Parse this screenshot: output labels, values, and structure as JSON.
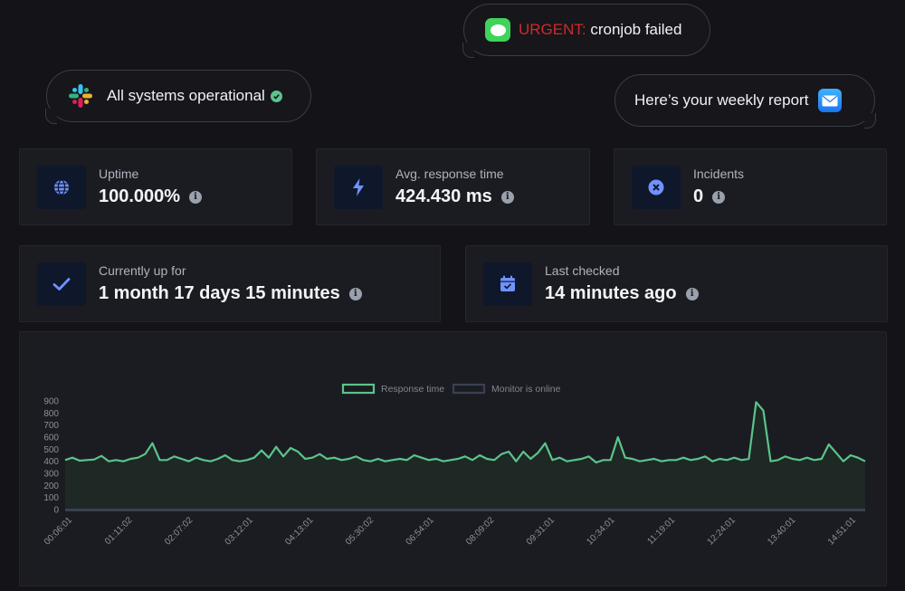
{
  "notifications": {
    "slack": {
      "text": "All systems operational",
      "icon": "slack-icon"
    },
    "sms": {
      "urgent_label": "URGENT:",
      "text": " cronjob failed",
      "icon": "messages-icon"
    },
    "mail": {
      "text": "Here’s your weekly report",
      "icon": "mail-icon"
    }
  },
  "stats": {
    "uptime": {
      "label": "Uptime",
      "value": "100.000%",
      "icon": "globe-icon"
    },
    "response": {
      "label": "Avg. response time",
      "value": "424.430 ms",
      "icon": "lightning-icon"
    },
    "incidents": {
      "label": "Incidents",
      "value": "0",
      "icon": "x-circle-icon"
    },
    "up_for": {
      "label": "Currently up for",
      "value": "1 month 17 days 15 minutes",
      "icon": "checkmark-icon"
    },
    "last_checked": {
      "label": "Last checked",
      "value": "14 minutes ago",
      "icon": "calendar-check-icon"
    }
  },
  "colors": {
    "response_line": "#5bc48b",
    "online_line": "#3b4052",
    "urgent": "#d02a2a",
    "icon_blue": "#6f92ff"
  },
  "chart_data": {
    "type": "line",
    "legend": [
      "Response time",
      "Monitor is online"
    ],
    "legend_position": "top-center",
    "ylim": [
      0,
      900
    ],
    "yticks": [
      0,
      100,
      200,
      300,
      400,
      500,
      600,
      700,
      800,
      900
    ],
    "x_tick_labels": [
      "00:06:01",
      "01:11:02",
      "02:07:02",
      "03:12:01",
      "04:13:01",
      "05:30:02",
      "06:54:01",
      "08:09:02",
      "09:31:01",
      "10:34:01",
      "11:19:01",
      "12:24:01",
      "13:40:01",
      "14:51:01"
    ],
    "series": [
      {
        "name": "Response time",
        "values": [
          410,
          430,
          405,
          410,
          415,
          445,
          400,
          410,
          400,
          420,
          430,
          460,
          550,
          410,
          410,
          440,
          420,
          400,
          430,
          410,
          400,
          420,
          450,
          410,
          400,
          410,
          430,
          490,
          430,
          520,
          440,
          510,
          480,
          420,
          430,
          460,
          420,
          430,
          410,
          420,
          440,
          410,
          400,
          420,
          400,
          410,
          420,
          410,
          450,
          430,
          410,
          420,
          400,
          410,
          420,
          440,
          410,
          450,
          420,
          410,
          460,
          480,
          400,
          480,
          420,
          470,
          550,
          410,
          430,
          400,
          410,
          420,
          440,
          390,
          410,
          410,
          600,
          430,
          420,
          400,
          410,
          420,
          400,
          410,
          410,
          430,
          410,
          420,
          440,
          400,
          420,
          410,
          430,
          410,
          420,
          890,
          820,
          400,
          410,
          440,
          420,
          410,
          430,
          410,
          420,
          540,
          470,
          400,
          450,
          430,
          400
        ],
        "color": "#5bc48b"
      },
      {
        "name": "Monitor is online",
        "values": [
          1,
          1,
          1,
          1,
          1,
          1,
          1,
          1,
          1,
          1,
          1,
          1,
          1,
          1,
          1,
          1,
          1,
          1,
          1,
          1,
          1,
          1,
          1,
          1,
          1,
          1,
          1,
          1,
          1,
          1,
          1,
          1,
          1,
          1,
          1,
          1,
          1,
          1,
          1,
          1,
          1,
          1,
          1,
          1,
          1,
          1,
          1,
          1,
          1,
          1,
          1,
          1,
          1,
          1,
          1,
          1,
          1,
          1,
          1,
          1,
          1,
          1,
          1,
          1,
          1,
          1,
          1,
          1,
          1,
          1,
          1,
          1,
          1,
          1,
          1,
          1,
          1,
          1,
          1,
          1,
          1,
          1,
          1,
          1,
          1,
          1,
          1,
          1,
          1,
          1,
          1,
          1,
          1,
          1,
          1,
          1,
          1,
          1,
          1,
          1,
          1,
          1,
          1,
          1,
          1,
          1,
          1,
          1,
          1,
          1,
          1
        ],
        "color": "#3b4052"
      }
    ],
    "grid": false
  }
}
